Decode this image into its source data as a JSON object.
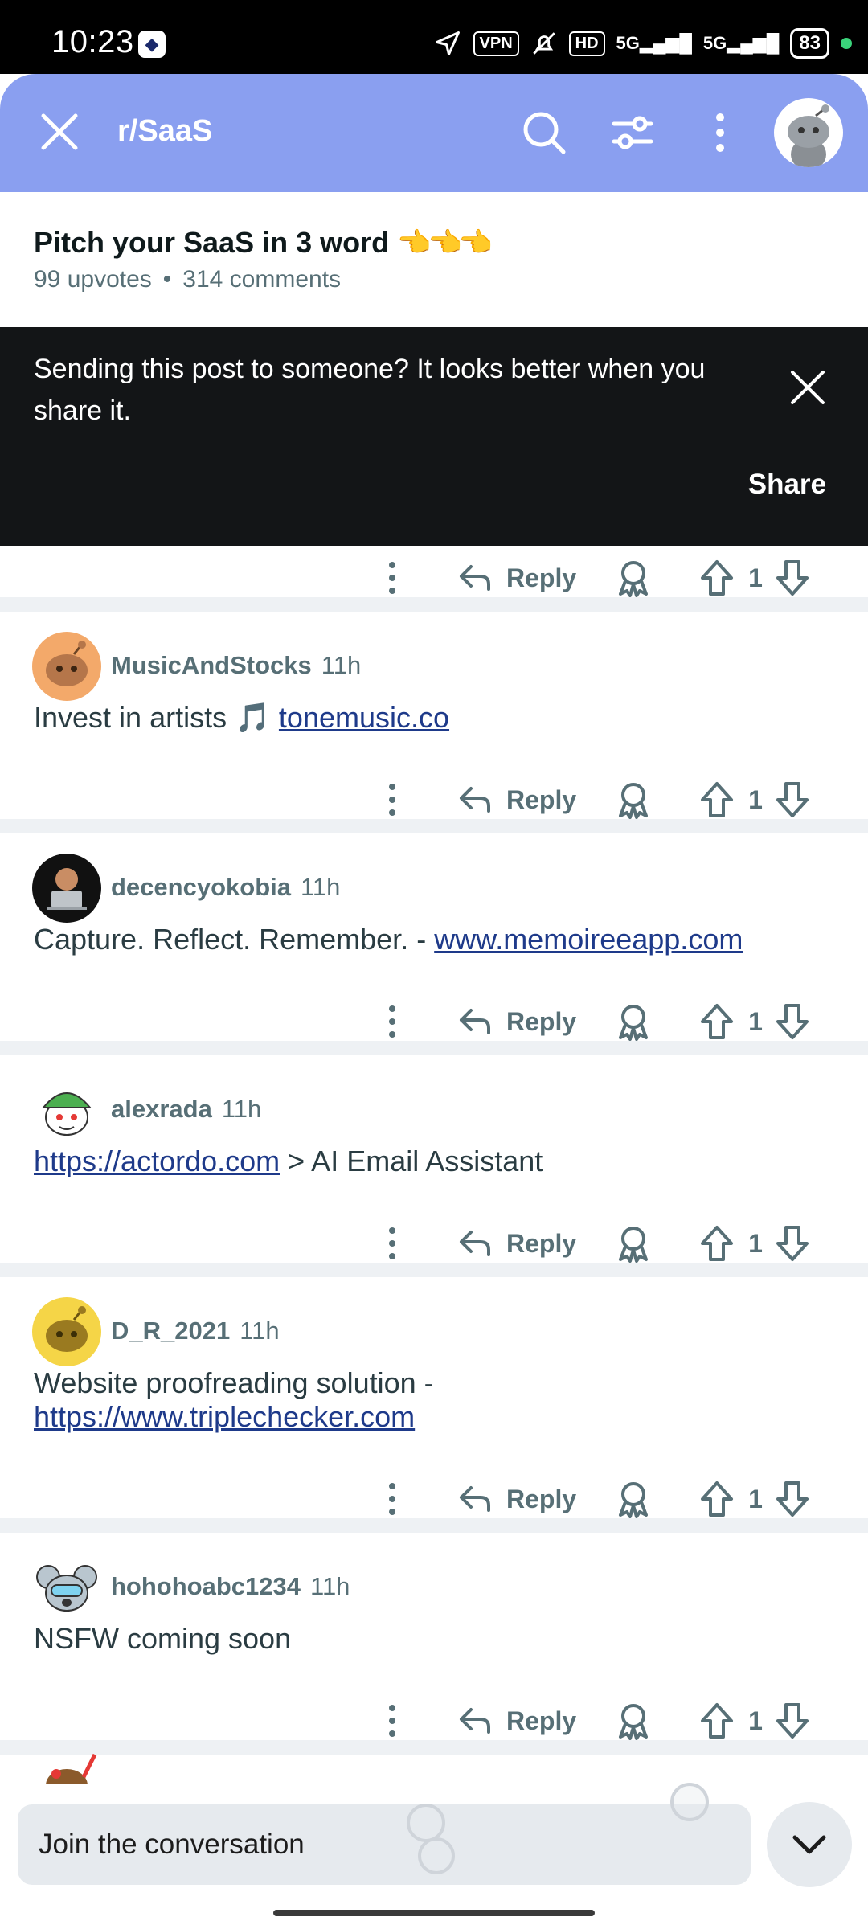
{
  "status_bar": {
    "time": "10:23",
    "vpn": "VPN",
    "hd": "HD",
    "net1": "5G",
    "net2": "5G",
    "battery": "83"
  },
  "header": {
    "subreddit": "r/SaaS",
    "icons": [
      "close-icon",
      "search-icon",
      "filter-icon",
      "more-icon",
      "avatar"
    ]
  },
  "post": {
    "title": "Pitch your SaaS in 3 word",
    "title_emoji": "👈👈👈",
    "upvotes": "99 upvotes",
    "separator": "•",
    "comments": "314 comments"
  },
  "share_banner": {
    "text": "Sending this post to someone? It looks better when you share it.",
    "share_label": "Share"
  },
  "actions": {
    "reply_label": "Reply"
  },
  "comments": [
    {
      "user": "MusicAndStocks",
      "time": "11h",
      "text_before": "Invest in artists 🎵 ",
      "link": "tonemusic.co",
      "text_after": "",
      "votes": "1",
      "avatar_color": "#f3a96a"
    },
    {
      "user": "decencyokobia",
      "time": "11h",
      "text_before": "Capture. Reflect. Remember. - ",
      "link": "www.memoireeapp.com",
      "text_after": "",
      "votes": "1",
      "avatar_color": "#111111"
    },
    {
      "user": "alexrada",
      "time": "11h",
      "text_before": "",
      "link": "https://actordo.com",
      "text_after": " > AI Email Assistant",
      "votes": "1",
      "avatar_color": "#ffffff"
    },
    {
      "user": "D_R_2021",
      "time": "11h",
      "text_before": "Website proofreading solution - ",
      "link": "https://www.triplechecker.com",
      "text_after": "",
      "votes": "1",
      "avatar_color": "#f5d547"
    },
    {
      "user": "hohohoabc1234",
      "time": "11h",
      "text_before": "NSFW coming soon",
      "link": "",
      "text_after": "",
      "votes": "1",
      "avatar_color": "#ffffff"
    }
  ],
  "top_partial_votes": "1",
  "bottom_bar": {
    "join_placeholder": "Join the conversation"
  },
  "colors": {
    "header_bg": "#8a9ff0",
    "banner_bg": "#131517",
    "link": "#1e3a8a",
    "meta": "#576f76"
  }
}
